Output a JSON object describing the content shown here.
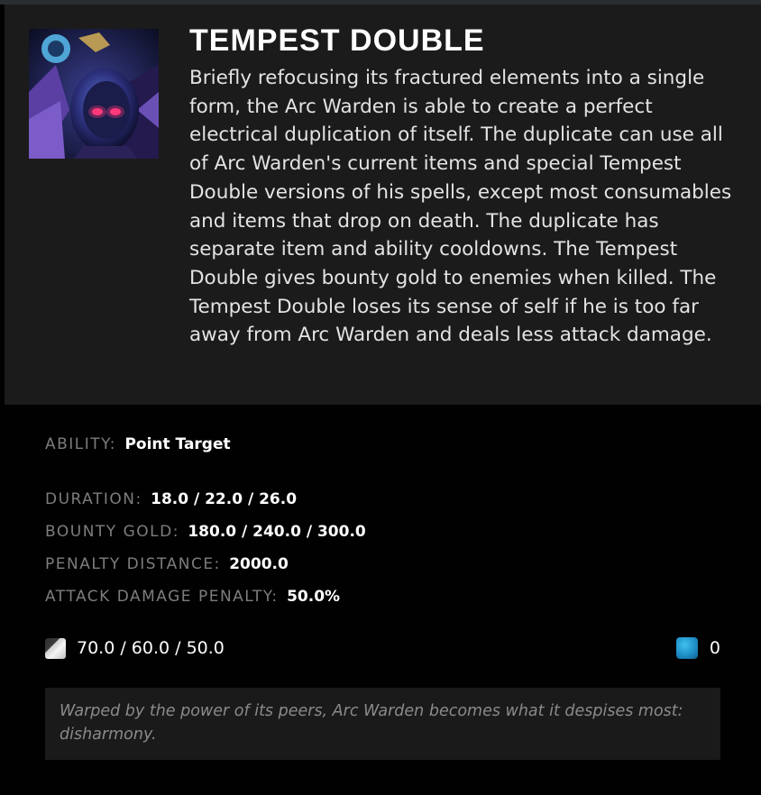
{
  "ability": {
    "title": "TEMPEST DOUBLE",
    "description": "Briefly refocusing its fractured elements into a single form, the Arc Warden is able to create a perfect electrical duplication of itself. The duplicate can use all of Arc Warden's current items and special Tempest Double versions of his spells, except most consumables and items that drop on death. The duplicate has separate item and ability cooldowns. The Tempest Double gives bounty gold to enemies when killed. The Tempest Double loses its sense of self if he is too far away from Arc Warden and deals less attack damage.",
    "icon": "arc-warden-tempest-double-portrait"
  },
  "stats": {
    "ability_type": {
      "label": "ABILITY:",
      "value": "Point Target"
    },
    "duration": {
      "label": "DURATION:",
      "value": "18.0 / 22.0 / 26.0"
    },
    "bounty_gold": {
      "label": "BOUNTY GOLD:",
      "value": "180.0 / 240.0 / 300.0"
    },
    "penalty_distance": {
      "label": "PENALTY DISTANCE:",
      "value": "2000.0"
    },
    "attack_damage_penalty": {
      "label": "ATTACK DAMAGE PENALTY:",
      "value": "50.0%"
    }
  },
  "costs": {
    "cooldown": "70.0 / 60.0 / 50.0",
    "cooldown_icon": "cooldown-icon",
    "mana": "0",
    "mana_icon": "mana-icon"
  },
  "lore": "Warped by the power of its peers, Arc Warden becomes what it despises most: disharmony.",
  "colors": {
    "header_bg": "#1b1b1b",
    "body_bg": "#010101",
    "label": "#7d7d7d",
    "value": "#ffffff",
    "mana": "#1f8fc8",
    "lore_box": "#1a1a1a"
  }
}
